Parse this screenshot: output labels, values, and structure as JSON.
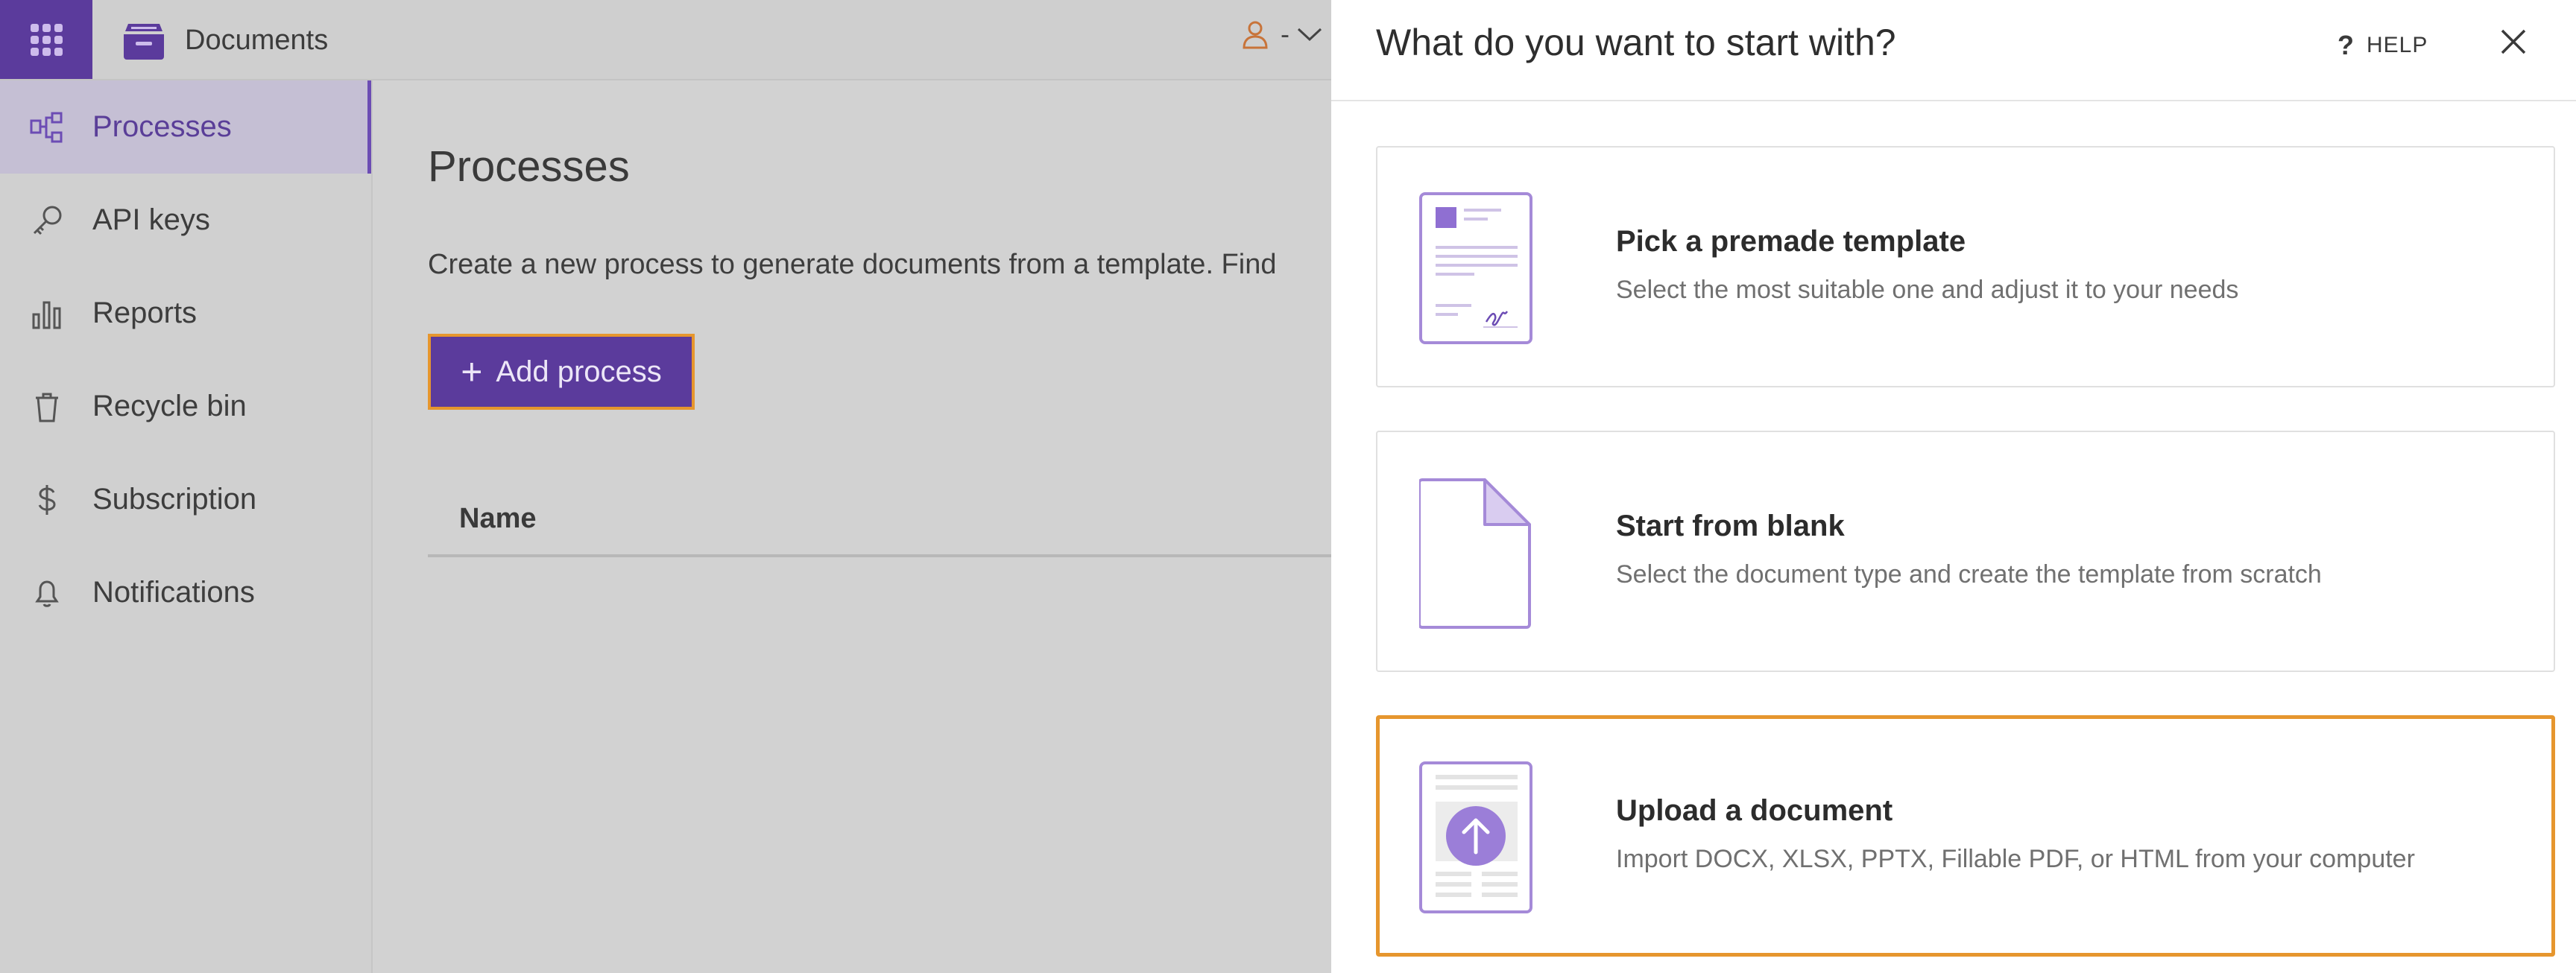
{
  "header": {
    "app_name": "Documents",
    "user_label": "-"
  },
  "sidebar": {
    "items": [
      {
        "label": "Processes",
        "icon": "processes-icon",
        "active": true
      },
      {
        "label": "API keys",
        "icon": "key-icon",
        "active": false
      },
      {
        "label": "Reports",
        "icon": "bar-chart-icon",
        "active": false
      },
      {
        "label": "Recycle bin",
        "icon": "trash-icon",
        "active": false
      },
      {
        "label": "Subscription",
        "icon": "dollar-icon",
        "active": false
      },
      {
        "label": "Notifications",
        "icon": "bell-icon",
        "active": false
      }
    ]
  },
  "main": {
    "title": "Processes",
    "description": "Create a new process to generate documents from a template. Find",
    "add_button": "Add process",
    "table": {
      "columns": [
        "Name"
      ]
    }
  },
  "drawer": {
    "title": "What do you want to start with?",
    "help_label": "HELP",
    "options": [
      {
        "title": "Pick a premade template",
        "subtitle": "Select the most suitable one and adjust it to your needs",
        "icon": "template-icon"
      },
      {
        "title": "Start from blank",
        "subtitle": "Select the document type and create the template from scratch",
        "icon": "blank-document-icon"
      },
      {
        "title": "Upload a document",
        "subtitle": "Import DOCX, XLSX, PPTX, Fillable PDF, or HTML from your computer",
        "icon": "upload-document-icon",
        "selected": true
      }
    ]
  },
  "colors": {
    "brand": "#5b3b9c",
    "accent_light": "#9b7ed8",
    "focus_outline": "#e6962e",
    "overlay_bg": "#d2d2d2"
  }
}
